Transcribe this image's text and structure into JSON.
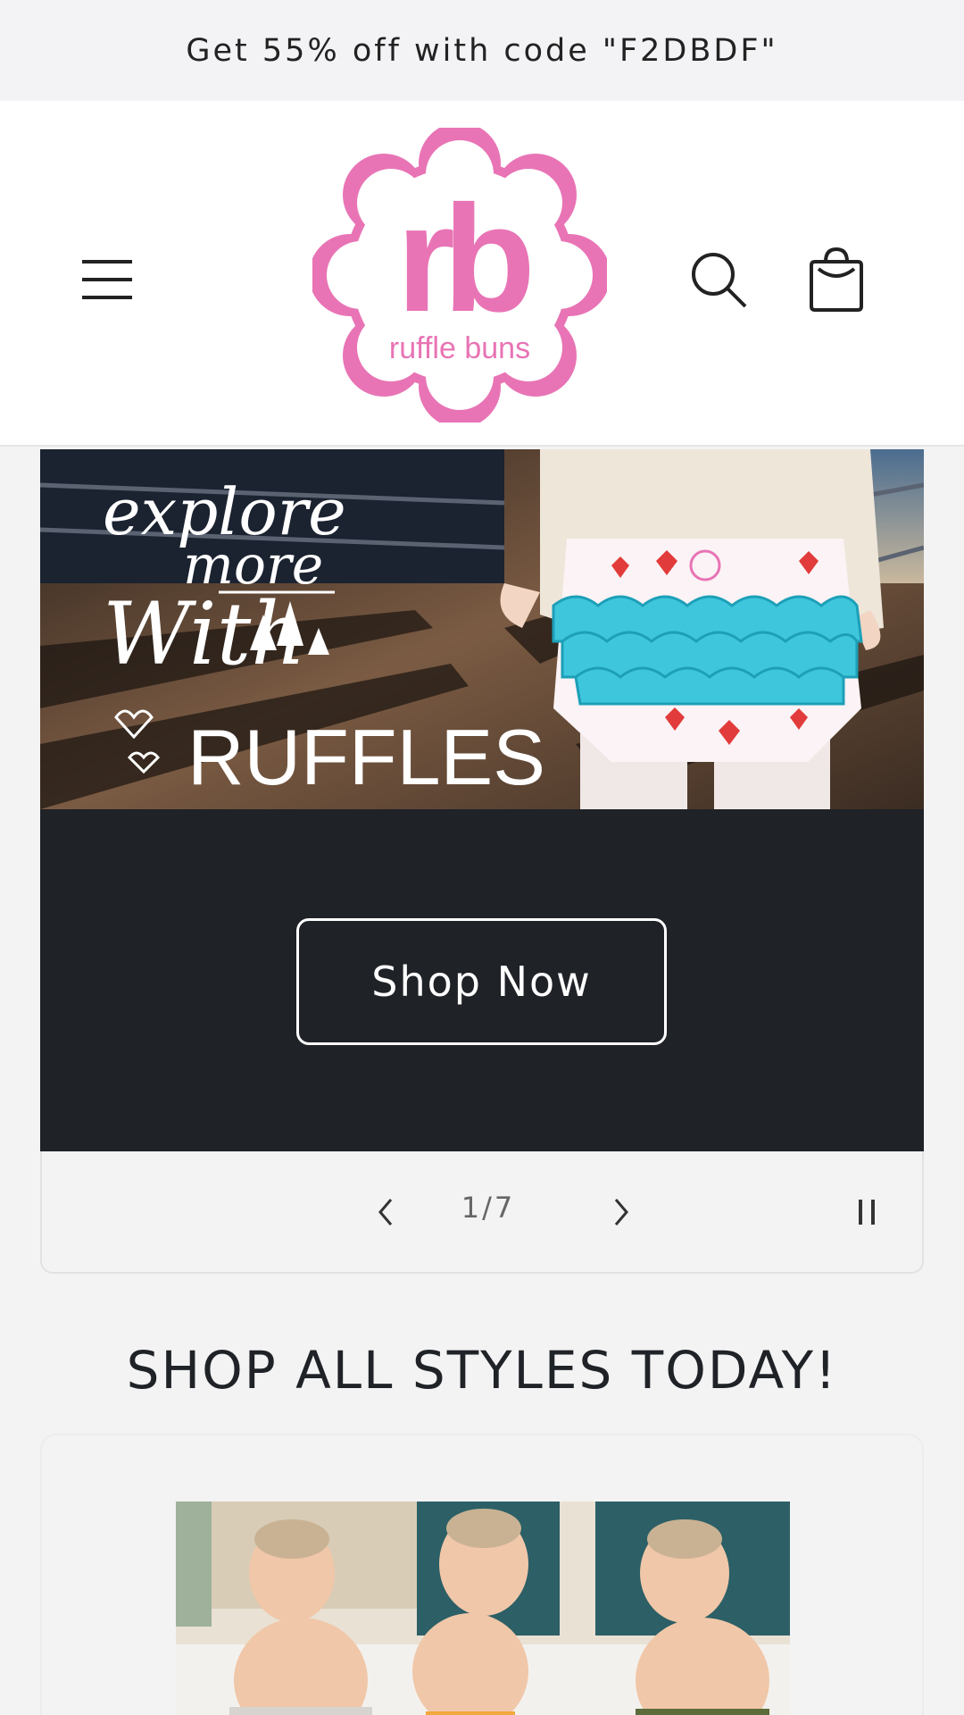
{
  "announcement": {
    "text": "Get 55% off with code \"F2DBDF\""
  },
  "header": {
    "brand_text": "ruffle buns",
    "logo_monogram": "rb",
    "icons": [
      "menu-icon",
      "search-icon",
      "cart-icon"
    ]
  },
  "hero": {
    "image_lettering": [
      "explore",
      "more",
      "With",
      "RUFFLES"
    ],
    "button_label": "Shop Now",
    "counter": "1/7"
  },
  "section": {
    "heading": "SHOP ALL STYLES TODAY!"
  },
  "colors": {
    "brand_pink": "#e874b5",
    "dark_panel": "#1f2227",
    "ruffle_blue": "#3ec6dc",
    "announcement_bg": "#f3f3f5"
  }
}
